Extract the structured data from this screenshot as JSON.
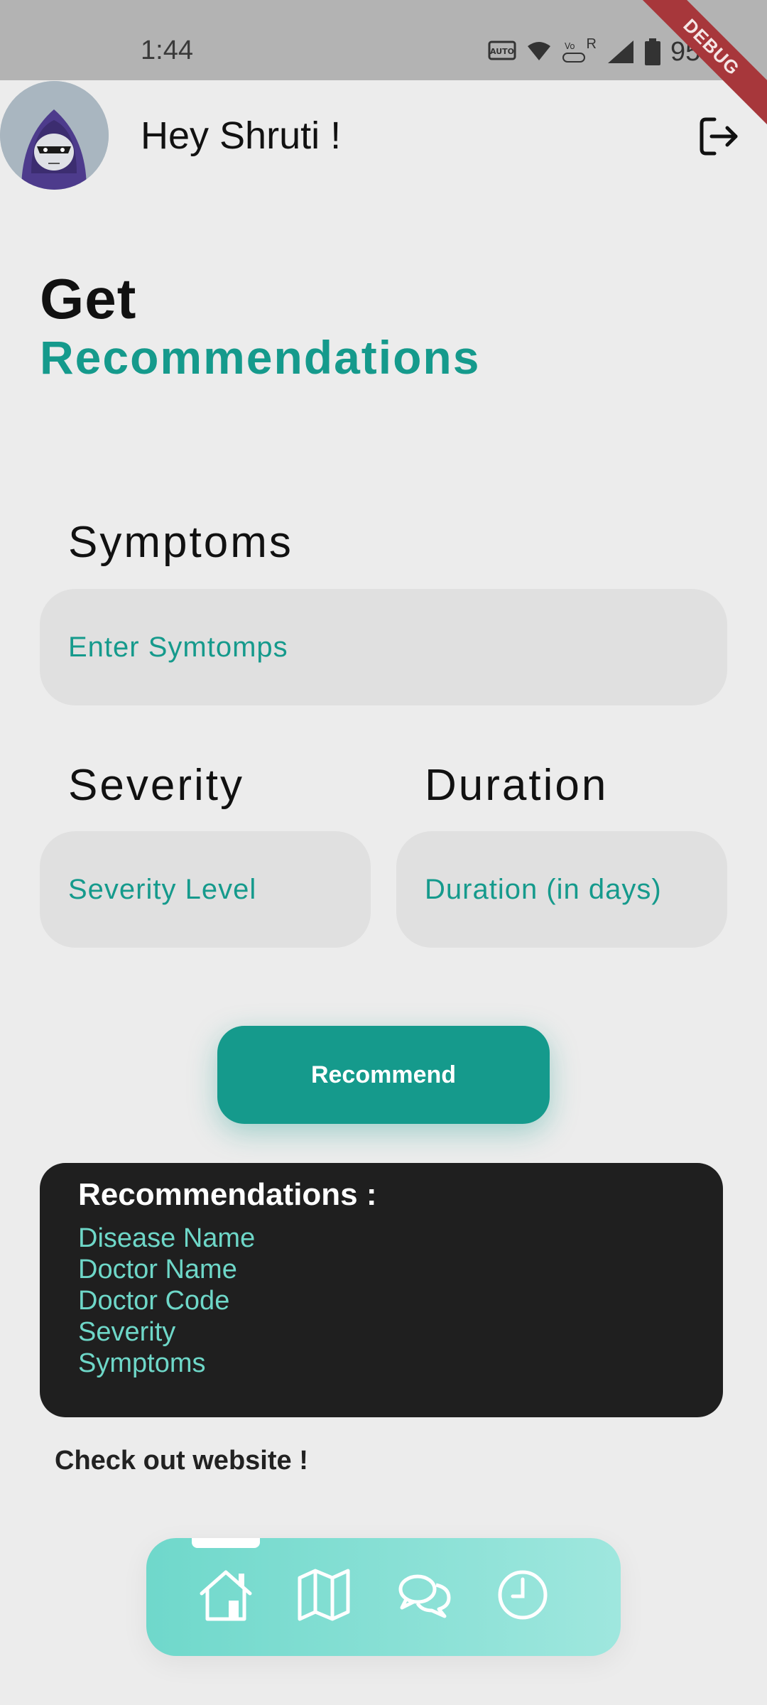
{
  "status": {
    "time": "1:44",
    "battery": "95%",
    "auto_label": "AUTO",
    "r_label": "R"
  },
  "debug": "DEBUG",
  "header": {
    "greeting": "Hey Shruti !"
  },
  "title": {
    "line1": "Get",
    "line2": "Recommendations"
  },
  "form": {
    "symptoms_label": "Symptoms",
    "symptoms_placeholder": "Enter Symtomps",
    "severity_label": "Severity",
    "severity_placeholder": "Severity Level",
    "duration_label": "Duration",
    "duration_placeholder": "Duration (in days)",
    "button": "Recommend"
  },
  "results": {
    "title": "Recommendations :",
    "items": [
      "Disease Name",
      "Doctor Name",
      "Doctor Code",
      "Severity",
      "Symptoms"
    ]
  },
  "link": "Check out website !",
  "nav": {
    "items": [
      "home-icon",
      "map-icon",
      "chat-icon",
      "history-icon"
    ],
    "active": "home-icon"
  },
  "colors": {
    "accent": "#159a8c",
    "accent_light": "#6ed7c8",
    "card_bg": "#1f1f1f",
    "status_bar": "#b3b3b3"
  }
}
